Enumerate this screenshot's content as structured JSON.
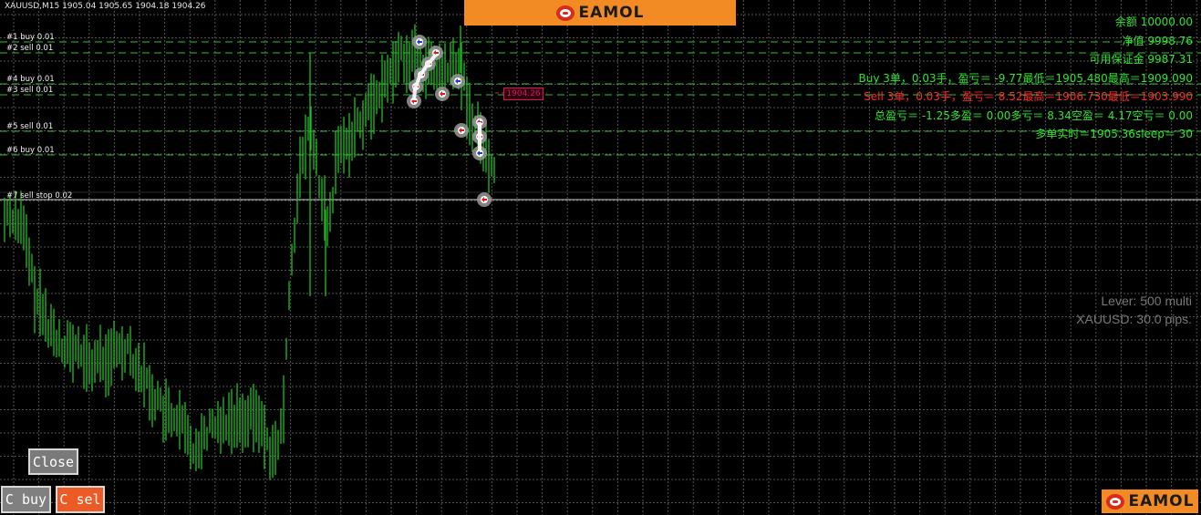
{
  "symbol_info": "XAUUSD,M15  1905.04 1905.65 1904.18 1904.26",
  "banner": {
    "logo_text": "EAMOL"
  },
  "corner_logo": {
    "logo_text": "EAMOL"
  },
  "order_lines": [
    {
      "label": "#1 buy 0.01"
    },
    {
      "label": "#2 sell 0.01"
    },
    {
      "label": "#4 buy 0.01"
    },
    {
      "label": "#3 sell 0.01"
    },
    {
      "label": "#5 sell 0.01"
    },
    {
      "label": "#6 buy 0.01"
    },
    {
      "label": "#7 sell stop 0.02"
    }
  ],
  "price_tag": "1904.26",
  "info_panel": [
    {
      "text": "余额 10000.00",
      "color": "#2ee62e"
    },
    {
      "text": "净值 9998.76",
      "color": "#2ee62e"
    },
    {
      "text": "可用保证金 9987.31",
      "color": "#2ee62e"
    },
    {
      "text": "Buy 3单，0.03手，盈亏＝ -9.77最低＝1905.480最高＝1909.090",
      "color": "#2ee62e"
    },
    {
      "text": "Sell 3单，0.03手，盈亏＝ 8.52最高＝1906.730最低＝1903.990",
      "color": "#ff2a2a"
    },
    {
      "text": "总盈亏＝ -1.25多盈＝ 0.00多亏＝ 8.34空盈＝ 4.17空亏＝ 0.00",
      "color": "#2ee62e"
    },
    {
      "text": "多单实时＝1905.36sleep＝ 30",
      "color": "#2ee62e"
    }
  ],
  "lever_text": "Lever: 500 multi",
  "pips_text": "XAUUSD: 30.0 pips.",
  "buttons": {
    "close_label": "Close",
    "cbuy_label": "C buy",
    "csel_label": "C sel"
  },
  "colors": {
    "bar": "#1fbf1f",
    "grid": "#6f6f6f",
    "dash_line": "#2fbf2f",
    "banner": "#f28b24",
    "sell_marker": "#e21b1b",
    "buy_marker": "#1b3be2"
  },
  "icons": [
    "eamol-logo-icon",
    "buy-arrow-icon",
    "sell-arrow-icon"
  ]
}
